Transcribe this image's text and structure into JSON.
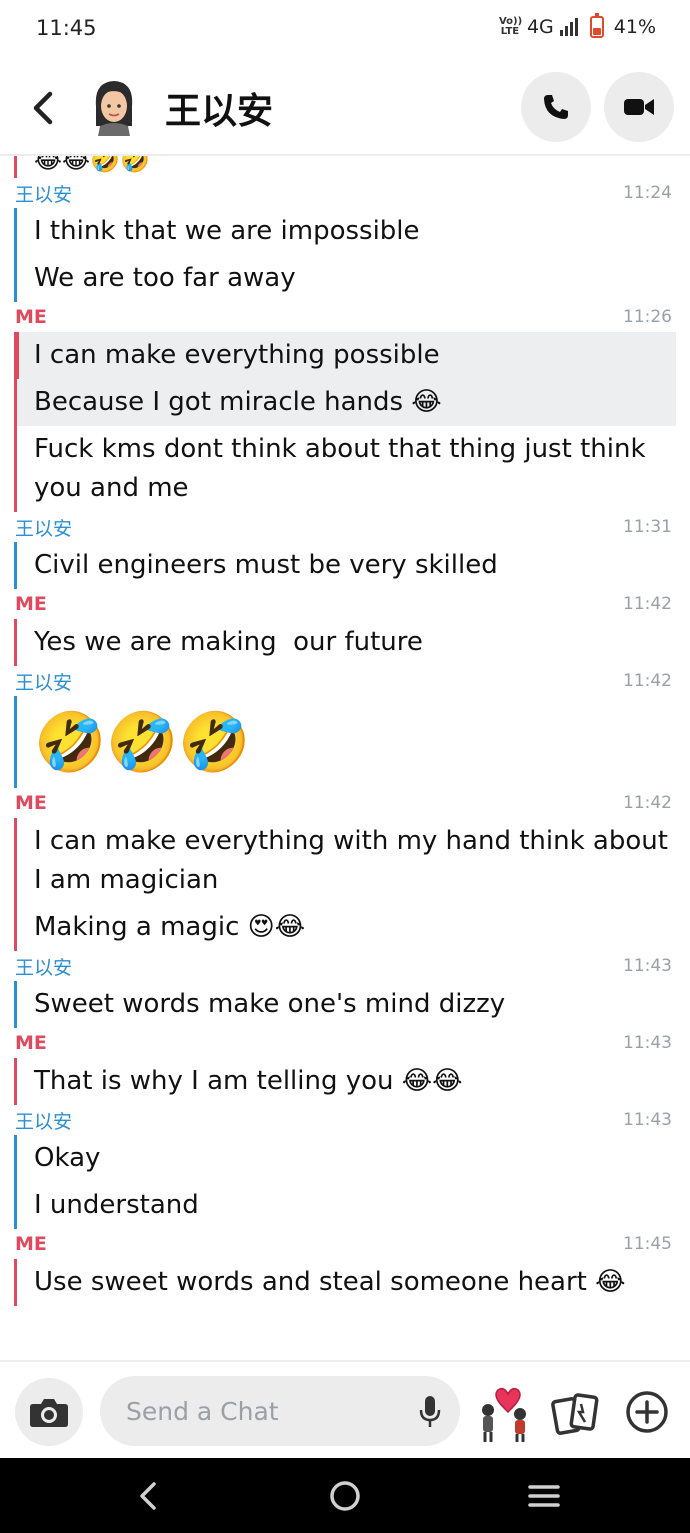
{
  "status_bar": {
    "time": "11:45",
    "volte": "Vo)) LTE",
    "network": "4G",
    "battery_percent": "41%",
    "battery_level": 0.41
  },
  "header": {
    "title": "王以安"
  },
  "colors": {
    "me_accent": "#e04a5e",
    "them_accent": "#2b8fd3",
    "highlight_bg": "#eceef0"
  },
  "messages": [
    {
      "type": "partial",
      "sender": "",
      "lines": [
        "😂😂🤣🤣"
      ]
    },
    {
      "sender": "王以安",
      "who": "them",
      "time": "11:24",
      "lines": [
        "I think that we are impossible",
        "We are too far away"
      ]
    },
    {
      "sender": "ME",
      "who": "me",
      "time": "11:26",
      "lines": [
        "I can make everything possible",
        "Because I got miracle hands 😂",
        "Fuck kms dont think about that thing just think you and me"
      ]
    },
    {
      "sender": "王以安",
      "who": "them",
      "time": "11:31",
      "lines": [
        "Civil engineers must be very skilled"
      ]
    },
    {
      "sender": "ME",
      "who": "me",
      "time": "11:42",
      "lines": [
        "Yes we are making  our future"
      ]
    },
    {
      "sender": "王以安",
      "who": "them",
      "time": "11:42",
      "lines": [
        "🤣🤣🤣"
      ]
    },
    {
      "sender": "ME",
      "who": "me",
      "time": "11:42",
      "lines": [
        "I can make everything with my hand think about I am magician",
        "Making a magic 😍😂"
      ]
    },
    {
      "sender": "王以安",
      "who": "them",
      "time": "11:43",
      "lines": [
        "Sweet words make one's mind dizzy"
      ]
    },
    {
      "sender": "ME",
      "who": "me",
      "time": "11:43",
      "lines": [
        "That is why I am telling you 😂😂"
      ]
    },
    {
      "sender": "王以安",
      "who": "them",
      "time": "11:43",
      "lines": [
        "Okay",
        "I understand"
      ]
    },
    {
      "sender": "ME",
      "who": "me",
      "time": "11:45",
      "lines": [
        "Use sweet words and steal someone heart 😂"
      ]
    }
  ],
  "composer": {
    "placeholder": "Send a Chat"
  },
  "icons": {
    "back": "chevron-left-icon",
    "call": "phone-icon",
    "video": "video-camera-icon",
    "camera": "camera-icon",
    "mic": "microphone-icon",
    "bitmoji": "bitmoji-sticker-icon",
    "cards": "cards-icon",
    "plus": "plus-circle-icon"
  }
}
